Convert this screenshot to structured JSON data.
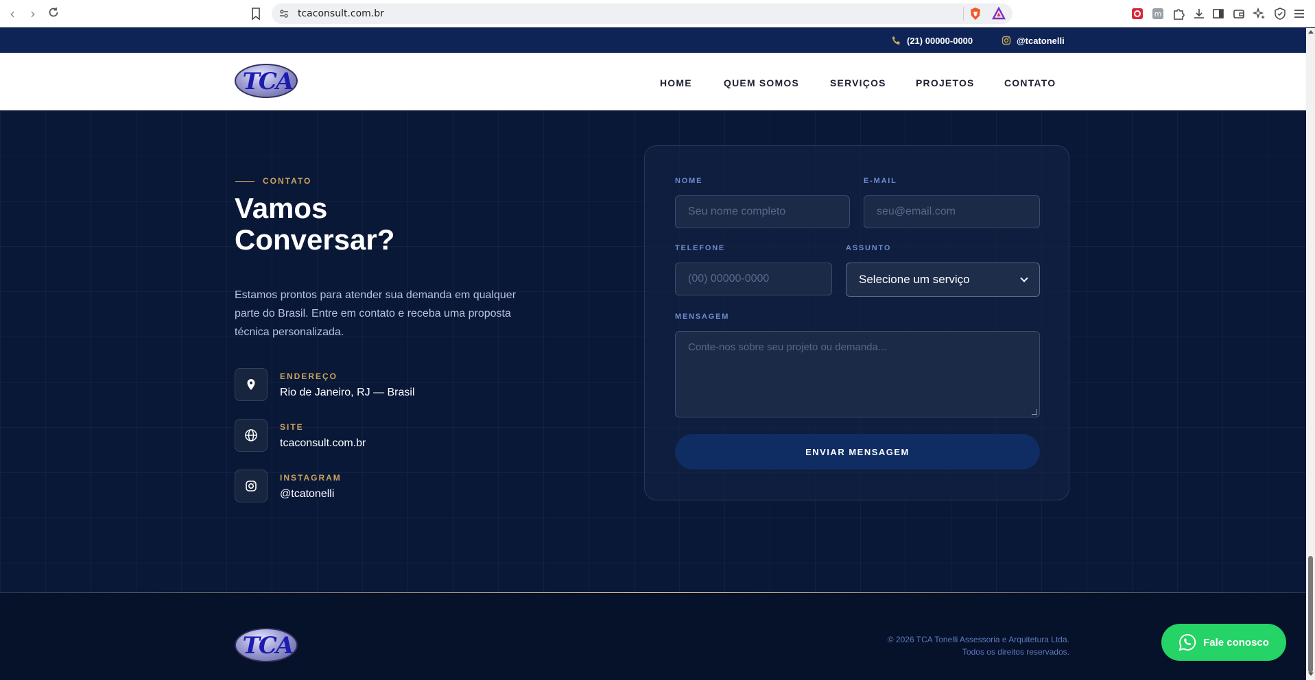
{
  "browser": {
    "url": "tcaconsult.com.br"
  },
  "topbar": {
    "phone": "(21) 00000-0000",
    "instagram": "@tcatonelli"
  },
  "header": {
    "logo_text": "TCA",
    "menu": [
      {
        "label": "HOME"
      },
      {
        "label": "QUEM SOMOS"
      },
      {
        "label": "SERVIÇOS"
      },
      {
        "label": "PROJETOS"
      },
      {
        "label": "CONTATO"
      }
    ]
  },
  "contact": {
    "section_label": "CONTATO",
    "heading": "Vamos Conversar?",
    "lead": "Estamos prontos para atender sua demanda em qualquer parte do Brasil. Entre em contato e receba uma proposta técnica personalizada.",
    "info": [
      {
        "icon": "map-pin-icon",
        "label": "ENDEREÇO",
        "value": "Rio de Janeiro, RJ — Brasil"
      },
      {
        "icon": "globe-icon",
        "label": "SITE",
        "value": "tcaconsult.com.br"
      },
      {
        "icon": "instagram-icon",
        "label": "INSTAGRAM",
        "value": "@tcatonelli"
      }
    ],
    "form": {
      "name_label": "NOME",
      "name_placeholder": "Seu nome completo",
      "email_label": "E-MAIL",
      "email_placeholder": "seu@email.com",
      "phone_label": "TELEFONE",
      "phone_placeholder": "(00) 00000-0000",
      "subject_label": "ASSUNTO",
      "subject_selected": "Selecione um serviço",
      "message_label": "MENSAGEM",
      "message_placeholder": "Conte-nos sobre seu projeto ou demanda...",
      "submit_label": "ENVIAR MENSAGEM"
    }
  },
  "footer": {
    "logo_text": "TCA",
    "copyright_line1": "© 2026 TCA Tonelli Assessoria e Arquitetura Ltda.",
    "copyright_line2": "Todos os direitos reservados."
  },
  "whatsapp": {
    "label": "Fale conosco"
  },
  "colors": {
    "navy": "#0a1838",
    "gold": "#c9a55a",
    "whatsapp_green": "#25d366"
  }
}
